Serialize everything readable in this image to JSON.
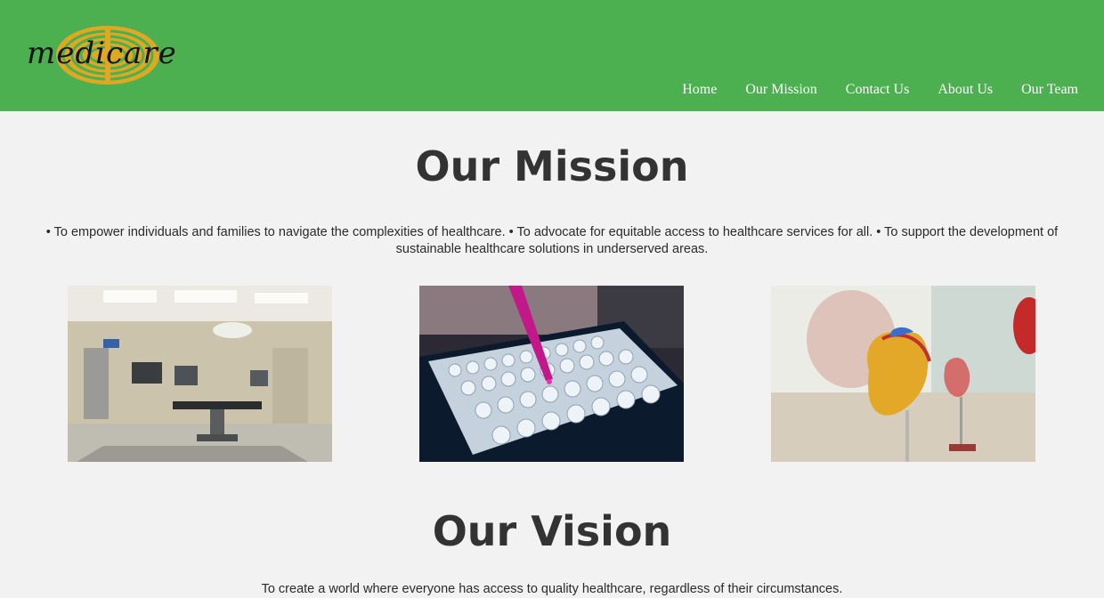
{
  "header": {
    "logo_text": "medicare",
    "nav": [
      {
        "label": "Home"
      },
      {
        "label": "Our Mission"
      },
      {
        "label": "Contact Us"
      },
      {
        "label": "About Us"
      },
      {
        "label": "Our Team"
      }
    ]
  },
  "mission": {
    "title": "Our Mission",
    "text": "• To empower individuals and families to navigate the complexities of healthcare. • To advocate for equitable access to healthcare services for all. • To support the development of sustainable healthcare solutions in underserved areas."
  },
  "vision": {
    "title": "Our Vision",
    "text": "To create a world where everyone has access to quality healthcare, regardless of their circumstances."
  },
  "colors": {
    "header_bg": "#4caf50",
    "page_bg": "#f2f2f2",
    "logo_gold": "#e0a722",
    "heading": "#333333"
  },
  "images": [
    {
      "icon": "operating-room-image"
    },
    {
      "icon": "lab-pipette-image"
    },
    {
      "icon": "heart-model-image"
    }
  ]
}
